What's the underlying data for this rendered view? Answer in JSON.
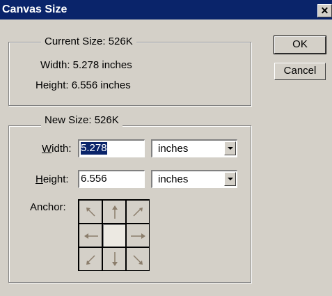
{
  "window": {
    "title": "Canvas Size",
    "close_glyph": "✕"
  },
  "current": {
    "legend": "Current Size: 526K",
    "width_text": "Width: 5.278 inches",
    "height_text": "Height: 6.556 inches"
  },
  "new_size": {
    "legend": "New Size: 526K",
    "width_label_key": "W",
    "width_label_rest": "idth:",
    "width_value": "5.278",
    "width_unit": "inches",
    "height_label_key": "H",
    "height_label_rest": "eight:",
    "height_value": "6.556",
    "height_unit": "inches",
    "anchor_label": "Anchor:"
  },
  "buttons": {
    "ok": "OK",
    "cancel": "Cancel"
  },
  "colors": {
    "titlebar": "#0a246a",
    "face": "#d4d0c8",
    "arrow": "#8b7d6b"
  }
}
